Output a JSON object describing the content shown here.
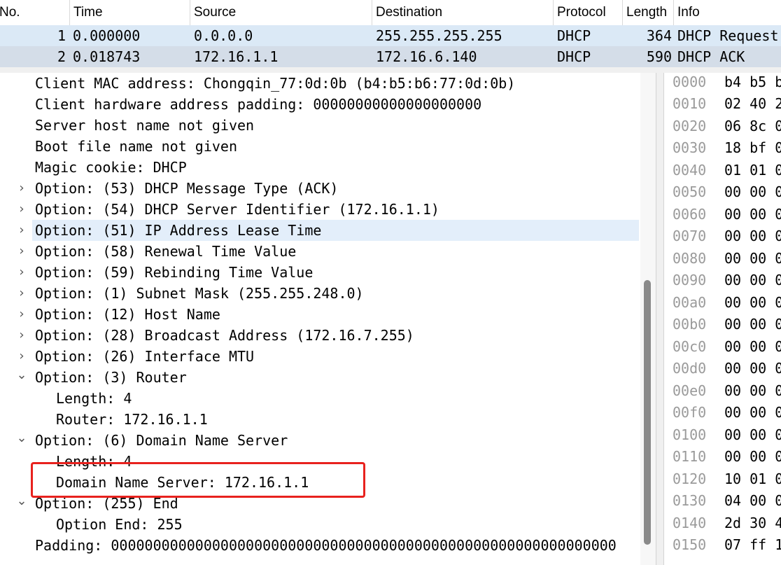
{
  "columns": [
    "No.",
    "Time",
    "Source",
    "Destination",
    "Protocol",
    "Length",
    "Info"
  ],
  "packets": [
    {
      "no": "1",
      "time": "0.000000",
      "source": "0.0.0.0",
      "destination": "255.255.255.255",
      "protocol": "DHCP",
      "length": "364",
      "info": "DHCP Request"
    },
    {
      "no": "2",
      "time": "0.018743",
      "source": "172.16.1.1",
      "destination": "172.16.6.140",
      "protocol": "DHCP",
      "length": "590",
      "info": "DHCP ACK"
    }
  ],
  "details": [
    {
      "text": "Client MAC address: Chongqin_77:0d:0b (b4:b5:b6:77:0d:0b)",
      "expander": ""
    },
    {
      "text": "Client hardware address padding: 00000000000000000000",
      "expander": ""
    },
    {
      "text": "Server host name not given",
      "expander": ""
    },
    {
      "text": "Boot file name not given",
      "expander": ""
    },
    {
      "text": "Magic cookie: DHCP",
      "expander": ""
    },
    {
      "text": "Option: (53) DHCP Message Type (ACK)",
      "expander": "›"
    },
    {
      "text": "Option: (54) DHCP Server Identifier (172.16.1.1)",
      "expander": "›"
    },
    {
      "text": "Option: (51) IP Address Lease Time",
      "expander": "›"
    },
    {
      "text": "Option: (58) Renewal Time Value",
      "expander": "›"
    },
    {
      "text": "Option: (59) Rebinding Time Value",
      "expander": "›"
    },
    {
      "text": "Option: (1) Subnet Mask (255.255.248.0)",
      "expander": "›"
    },
    {
      "text": "Option: (12) Host Name",
      "expander": "›"
    },
    {
      "text": "Option: (28) Broadcast Address (172.16.7.255)",
      "expander": "›"
    },
    {
      "text": "Option: (26) Interface MTU",
      "expander": "›"
    },
    {
      "text": "Option: (3) Router",
      "expander": "⌄"
    },
    {
      "text": "Length: 4",
      "expander": ""
    },
    {
      "text": "Router: 172.16.1.1",
      "expander": ""
    },
    {
      "text": "Option: (6) Domain Name Server",
      "expander": "⌄"
    },
    {
      "text": "Length: 4",
      "expander": ""
    },
    {
      "text": "Domain Name Server: 172.16.1.1",
      "expander": ""
    },
    {
      "text": "Option: (255) End",
      "expander": "⌄"
    },
    {
      "text": "Option End: 255",
      "expander": ""
    },
    {
      "text": "Padding: 000000000000000000000000000000000000000000000000000000000000",
      "expander": ""
    }
  ],
  "hex_rows": [
    {
      "offset": "0000",
      "bytes": "b4 b5 b"
    },
    {
      "offset": "0010",
      "bytes": "02 40 2"
    },
    {
      "offset": "0020",
      "bytes": "06 8c 0"
    },
    {
      "offset": "0030",
      "bytes": "18 bf 0"
    },
    {
      "offset": "0040",
      "bytes": "01 01 0"
    },
    {
      "offset": "0050",
      "bytes": "00 00 0"
    },
    {
      "offset": "0060",
      "bytes": "00 00 0"
    },
    {
      "offset": "0070",
      "bytes": "00 00 0"
    },
    {
      "offset": "0080",
      "bytes": "00 00 0"
    },
    {
      "offset": "0090",
      "bytes": "00 00 0"
    },
    {
      "offset": "00a0",
      "bytes": "00 00 0"
    },
    {
      "offset": "00b0",
      "bytes": "00 00 0"
    },
    {
      "offset": "00c0",
      "bytes": "00 00 0"
    },
    {
      "offset": "00d0",
      "bytes": "00 00 0"
    },
    {
      "offset": "00e0",
      "bytes": "00 00 0"
    },
    {
      "offset": "00f0",
      "bytes": "00 00 0"
    },
    {
      "offset": "0100",
      "bytes": "00 00 0"
    },
    {
      "offset": "0110",
      "bytes": "00 00 0"
    },
    {
      "offset": "0120",
      "bytes": "10 01 0"
    },
    {
      "offset": "0130",
      "bytes": "04 00 0"
    },
    {
      "offset": "0140",
      "bytes": "2d 30 4"
    },
    {
      "offset": "0150",
      "bytes": "07 ff 1"
    }
  ],
  "colors": {
    "row1_bg": "#dbe9f6",
    "row2_bg": "#d4dde8",
    "selected_detail_bg": "#e3eefa",
    "highlight_box": "#e8221e",
    "offset_text": "#9a9a9a"
  }
}
